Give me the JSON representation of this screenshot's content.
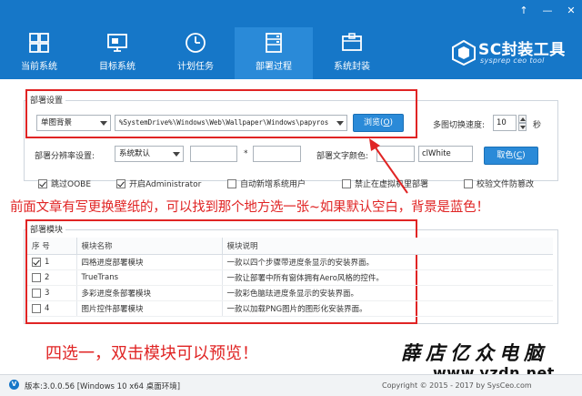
{
  "window": {
    "controls": [
      "↑",
      "—",
      "✕"
    ]
  },
  "nav": {
    "items": [
      {
        "label": "当前系统",
        "icon": "windows-icon"
      },
      {
        "label": "目标系统",
        "icon": "monitor-icon"
      },
      {
        "label": "计划任务",
        "icon": "clock-icon"
      },
      {
        "label": "部署过程",
        "icon": "server-icon",
        "active": true
      },
      {
        "label": "系统封装",
        "icon": "package-icon"
      }
    ]
  },
  "logo": {
    "title": "SC封装工具",
    "subtitle": "sysprep ceo tool"
  },
  "deploy": {
    "section_title": "部署设置",
    "bg_mode": "单图背景",
    "wallpaper_path": "%SystemDrive%\\Windows\\Web\\Wallpaper\\Windows\\papyros",
    "browse_label": "浏览(",
    "browse_key": "O",
    "browse_tail": ")",
    "multi_speed_label": "多图切换速度:",
    "multi_speed_value": "10",
    "multi_speed_unit": "秒",
    "resolution_label": "部署分辨率设置:",
    "resolution_value": "系统默认",
    "resolution_width": "",
    "resolution_sep": "*",
    "resolution_height": "",
    "text_color_label": "部署文字颜色:",
    "text_color_swatch": "",
    "text_color_value": "clWhite",
    "cancel_color_label": "取色(",
    "cancel_color_key": "C",
    "cancel_color_tail": ")",
    "options": [
      {
        "label": "跳过OOBE",
        "checked": true
      },
      {
        "label": "开启Administrator",
        "checked": true
      },
      {
        "label": "自动新增系统用户",
        "checked": false
      },
      {
        "label": "禁止在虚拟机里部署",
        "checked": false
      },
      {
        "label": "校验文件防篡改",
        "checked": false
      }
    ]
  },
  "annotations": {
    "top": "前面文章有写更换壁纸的，可以找到那个地方选一张~如果默认空白，背景是蓝色！",
    "bottom": "四选一，双击模块可以预览！"
  },
  "modules": {
    "section_title": "部署模块",
    "columns": [
      "序 号",
      "模块名称",
      "模块说明"
    ],
    "rows": [
      {
        "no": "1",
        "checked": true,
        "name": "四格进度部署模块",
        "desc": "一款以四个步骤带进度条显示的安装界面。"
      },
      {
        "no": "2",
        "checked": false,
        "name": "TrueTrans",
        "desc": "一款让部署中所有窗体拥有Aero风格的控件。"
      },
      {
        "no": "3",
        "checked": false,
        "name": "多彩进度条部署模块",
        "desc": "一款彩色脑珐进度条显示的安装界面。"
      },
      {
        "no": "4",
        "checked": false,
        "name": "图片控件部署模块",
        "desc": "一款以加载PNG图片的图形化安装界面。"
      }
    ]
  },
  "status": {
    "version": "版本:3.0.0.56 [Windows 10 x64 桌面环境]",
    "copyright": "Copyright © 2015 - 2017 by SysCeo.com"
  },
  "watermark": {
    "line1": "薛店亿众电脑",
    "line2": "www.yzdn.net"
  },
  "colors": {
    "header": "#1677c8",
    "accent": "#2a8ad8",
    "annotation": "#e02424"
  }
}
